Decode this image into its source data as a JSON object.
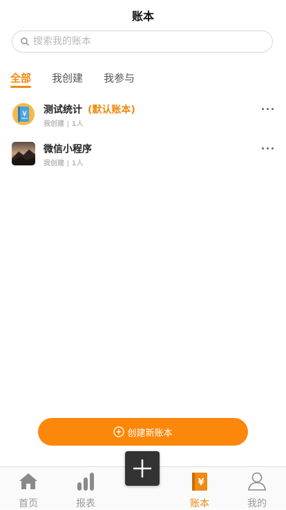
{
  "header": {
    "title": "账本"
  },
  "search": {
    "placeholder": "搜索我的账本"
  },
  "tabs": [
    {
      "label": "全部",
      "active": true
    },
    {
      "label": "我创建",
      "active": false
    },
    {
      "label": "我参与",
      "active": false
    }
  ],
  "books": [
    {
      "name": "测试统计",
      "default_tag": "(默认账本)",
      "meta": "我创建 | 1人",
      "icon": "ledger-yen-icon"
    },
    {
      "name": "微信小程序",
      "default_tag": "",
      "meta": "我创建 | 1人",
      "icon": "landscape-photo"
    }
  ],
  "create_button": {
    "label": "创建新账本"
  },
  "tabbar": [
    {
      "label": "首页",
      "icon": "home-icon",
      "active": false
    },
    {
      "label": "报表",
      "icon": "bar-chart-icon",
      "active": false
    },
    {
      "label": "账本",
      "icon": "ledger-icon",
      "active": true
    },
    {
      "label": "我的",
      "icon": "user-icon",
      "active": false
    }
  ],
  "colors": {
    "accent": "#f08a10",
    "button": "#fb880a",
    "plus_button": "#333333"
  }
}
